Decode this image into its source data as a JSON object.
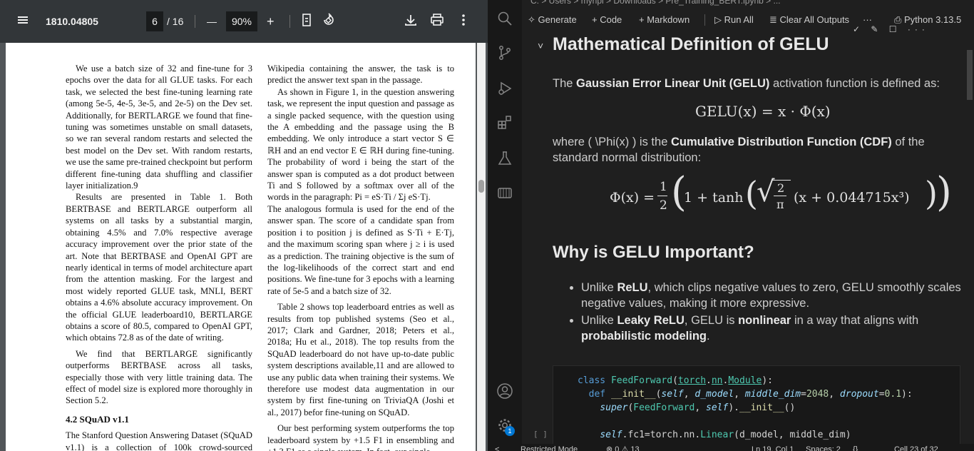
{
  "pdf": {
    "toolbar": {
      "menu_icon": "hamburger-menu-icon",
      "title": "1810.04805",
      "page_current": "6",
      "page_total": "/ 16",
      "zoom_out": "—",
      "zoom": "90%",
      "zoom_in": "+",
      "icons": [
        "fit-page-icon",
        "rotate-icon",
        "download-icon",
        "print-icon",
        "more-options-icon"
      ]
    },
    "left_column": [
      "We use a batch size of 32 and fine-tune for 3 epochs over the data for all GLUE tasks. For each task, we selected the best fine-tuning learning rate (among 5e-5, 4e-5, 3e-5, and 2e-5) on the Dev set. Additionally, for BERTLARGE we found that fine-tuning was sometimes unstable on small datasets, so we ran several random restarts and selected the best model on the Dev set. With random restarts, we use the same pre-trained checkpoint but perform different fine-tuning data shuffling and classifier layer initialization.9",
      "Results are presented in Table 1. Both BERTBASE and BERTLARGE outperform all systems on all tasks by a substantial margin, obtaining 4.5% and 7.0% respective average accuracy improvement over the prior state of the art. Note that BERTBASE and OpenAI GPT are nearly identical in terms of model architecture apart from the attention masking. For the largest and most widely reported GLUE task, MNLI, BERT obtains a 4.6% absolute accuracy improvement. On the official GLUE leaderboard10, BERTLARGE obtains a score of 80.5, compared to OpenAI GPT, which obtains 72.8 as of the date of writing.",
      "We find that BERTLARGE significantly outperforms BERTBASE across all tasks, especially those with very little training data. The effect of model size is explored more thoroughly in Section 5.2."
    ],
    "section_heading": "4.2   SQuAD v1.1",
    "left_column_end": "The Stanford Question Answering Dataset (SQuAD v1.1) is a collection of 100k crowd-sourced question/answer pairs (Rajpurkar et al.,",
    "right_column": [
      "Wikipedia containing the answer, the task is to predict the answer text span in the passage.",
      "As shown in Figure 1, in the question answering task, we represent the input question and passage as a single packed sequence, with the question using the A embedding and the passage using the B embedding. We only introduce a start vector S ∈ ℝH and an end vector E ∈ ℝH during fine-tuning. The probability of word i being the start of the answer span is computed as a dot product between Ti and S followed by a softmax over all of the words in the paragraph: Pi = eS·Ti / Σj eS·Tj.",
      "The analogous formula is used for the end of the answer span. The score of a candidate span from position i to position j is defined as S·Ti + E·Tj, and the maximum scoring span where j ≥ i is used as a prediction. The training objective is the sum of the log-likelihoods of the correct start and end positions. We fine-tune for 3 epochs with a learning rate of 5e-5 and a batch size of 32.",
      "Table 2 shows top leaderboard entries as well as results from top published systems (Seo et al., 2017; Clark and Gardner, 2018; Peters et al., 2018a; Hu et al., 2018). The top results from the SQuAD leaderboard do not have up-to-date public system descriptions available,11 and are allowed to use any public data when training their systems. We therefore use modest data augmentation in our system by first fine-tuning on TriviaQA (Joshi et al., 2017) befor fine-tuning on SQuAD.",
      "Our best performing system outperforms the top leaderboard system by +1.5 F1 in ensembling and +1.3 F1 as a single system. In fact, our single"
    ]
  },
  "vscode": {
    "path": "C: > Users > myhpl > Downloads > Pre_Training_BERT.ipynb > ...",
    "activity_icons": [
      "search-icon",
      "source-control-icon",
      "run-debug-icon",
      "extensions-icon",
      "testing-icon",
      "remote-explorer-icon",
      "account-icon",
      "settings-gear-icon"
    ],
    "toolbar": {
      "generate": "Generate",
      "code": "+ Code",
      "markdown": "+ Markdown",
      "run_all": "Run All",
      "clear_outputs": "Clear All Outputs",
      "more": "···",
      "kernel": "Python 3.13.5"
    },
    "markdown": {
      "h1": "Mathematical Definition of GELU",
      "p1_pre": "The ",
      "p1_bold": "Gaussian Error Linear Unit (GELU)",
      "p1_post": " activation function is defined as:",
      "eq1": "GELU(x) = x · Φ(x)",
      "p2_pre": "where ( \\Phi(x) ) is the ",
      "p2_bold": "Cumulative Distribution Function (CDF)",
      "p2_post": " of the standard normal distribution:",
      "eq2_lhs": "Φ(x) =",
      "eq2_half_num": "1",
      "eq2_half_den": "2",
      "eq2_body": "1 + tanh",
      "eq2_sqrt_num": "2",
      "eq2_sqrt_den": "π",
      "eq2_tail": "(x + 0.044715x³)",
      "h2": "Why is GELU Important?",
      "bullet1_pre": "Unlike ",
      "bullet1_bold": "ReLU",
      "bullet1_post": ", which clips negative values to zero, GELU smoothly scales negative values, making it more expressive.",
      "bullet2_pre": "Unlike ",
      "bullet2_bold1": "Leaky ReLU",
      "bullet2_mid": ", GELU is ",
      "bullet2_bold2": "nonlinear",
      "bullet2_mid2": " in a way that aligns with ",
      "bullet2_bold3": "probabilistic modeling",
      "bullet2_post": "."
    },
    "code": {
      "line1": "class FeedForward(torch.nn.Module):",
      "line2": "  def __init__(self, d_model, middle_dim=2048, dropout=0.1):",
      "line3": "    super(FeedForward, self).__init__()",
      "line4": "    self.fc1=torch.nn.Linear(d_model, middle_dim)",
      "exec_count": "[ ]"
    },
    "statusbar": {
      "mode": "Restricted Mode",
      "problems": "⊗ 0 ⚠ 13",
      "position": "Ln 19, Col 1",
      "spaces": "Spaces: 2",
      "braces": "{}",
      "cell": "Cell 23 of 32"
    },
    "badge": "1"
  }
}
